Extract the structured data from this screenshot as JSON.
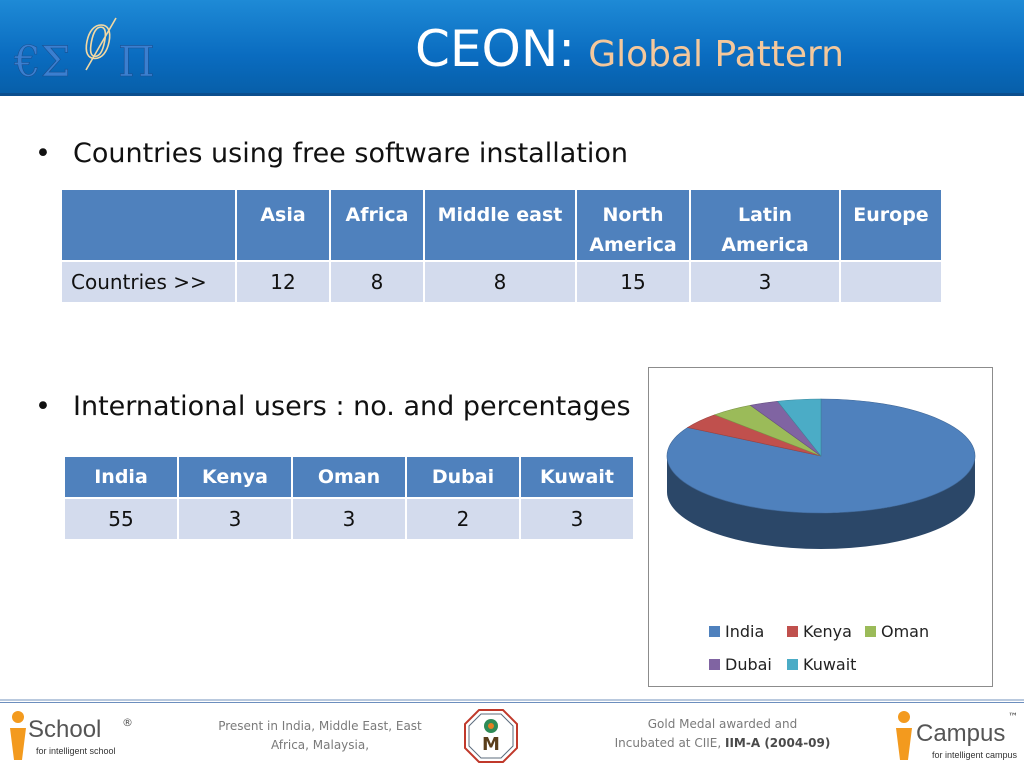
{
  "header": {
    "logo_text": "€Σ0Π",
    "title_main": "CEON:",
    "title_sub": "Global Pattern"
  },
  "bullet1": "Countries using free software installation",
  "table1": {
    "headers": [
      "",
      "Asia",
      "Africa",
      "Middle east",
      "North America",
      "Latin America",
      "Europe"
    ],
    "header_lines": {
      "north": [
        "North",
        "America"
      ],
      "latin": [
        "Latin",
        "America"
      ]
    },
    "row_label": "Countries >>",
    "values": [
      "12",
      "8",
      "8",
      "15",
      "3",
      ""
    ]
  },
  "bullet2": "International users : no. and percentages",
  "table2": {
    "headers": [
      "India",
      "Kenya",
      "Oman",
      "Dubai",
      "Kuwait"
    ],
    "values": [
      "55",
      "3",
      "3",
      "2",
      "3"
    ]
  },
  "chart_data": {
    "type": "pie",
    "title": "",
    "labels": [
      "India",
      "Kenya",
      "Oman",
      "Dubai",
      "Kuwait"
    ],
    "values": [
      55,
      3,
      3,
      2,
      3
    ],
    "colors": [
      "#4f81bd",
      "#c0504d",
      "#9bbb59",
      "#8064a2",
      "#4bacc6"
    ],
    "legend_position": "bottom",
    "style": "3d"
  },
  "footer": {
    "ischool_brand": "School",
    "ischool_tag": "for intelligent school",
    "presence_line1": "Present in India, Middle East, East",
    "presence_line2": "Africa, Malaysia,",
    "badge_letter": "M",
    "award_line1": "Gold Medal awarded and",
    "award_line2_pre": "Incubated at CIIE, ",
    "award_line2_bold": "IIM-A (2004-09)",
    "icampus_brand": "Campus",
    "icampus_tag": "for intelligent campus",
    "tm": "™"
  }
}
